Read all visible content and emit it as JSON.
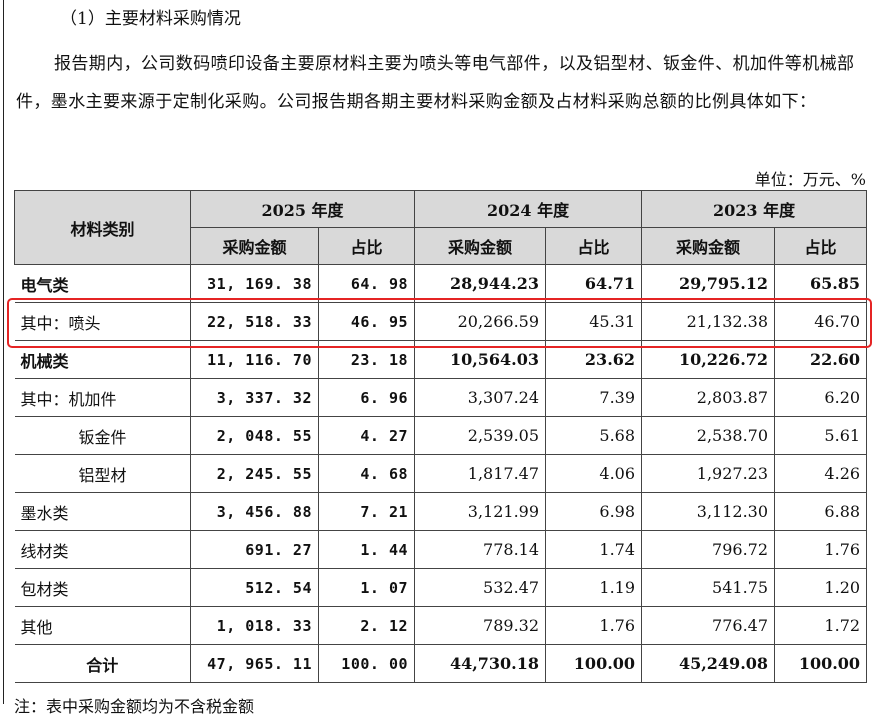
{
  "section_heading": "（1）主要材料采购情况",
  "paragraph": "报告期内，公司数码喷印设备主要原材料主要为喷头等电气部件，以及铝型材、钣金件、机加件等机械部件，墨水主要来源于定制化采购。公司报告期各期主要材料采购金额及占材料采购总额的比例具体如下：",
  "unit_label": "单位：万元、%",
  "table": {
    "category_header": "材料类别",
    "years": [
      "2025 年度",
      "2024 年度",
      "2023 年度"
    ],
    "amount_header": "采购金额",
    "ratio_header": "占比",
    "rows": [
      {
        "label": "电气类",
        "v": [
          "31, 169. 38",
          "64. 98",
          "28,944.23",
          "64.71",
          "29,795.12",
          "65.85"
        ]
      },
      {
        "label": "其中：喷头",
        "v": [
          "22, 518. 33",
          "46. 95",
          "20,266.59",
          "45.31",
          "21,132.38",
          "46.70"
        ]
      },
      {
        "label": "机械类",
        "v": [
          "11, 116. 70",
          "23. 18",
          "10,564.03",
          "23.62",
          "10,226.72",
          "22.60"
        ]
      },
      {
        "label": "其中：机加件",
        "v": [
          "3, 337. 32",
          "6. 96",
          "3,307.24",
          "7.39",
          "2,803.87",
          "6.20"
        ]
      },
      {
        "label": "钣金件",
        "v": [
          "2, 048. 55",
          "4. 27",
          "2,539.05",
          "5.68",
          "2,538.70",
          "5.61"
        ]
      },
      {
        "label": "铝型材",
        "v": [
          "2, 245. 55",
          "4. 68",
          "1,817.47",
          "4.06",
          "1,927.23",
          "4.26"
        ]
      },
      {
        "label": "墨水类",
        "v": [
          "3, 456. 88",
          "7. 21",
          "3,121.99",
          "6.98",
          "3,112.30",
          "6.88"
        ]
      },
      {
        "label": "线材类",
        "v": [
          "691. 27",
          "1. 44",
          "778.14",
          "1.74",
          "796.72",
          "1.76"
        ]
      },
      {
        "label": "包材类",
        "v": [
          "512. 54",
          "1. 07",
          "532.47",
          "1.19",
          "541.75",
          "1.20"
        ]
      },
      {
        "label": "其他",
        "v": [
          "1, 018. 33",
          "2. 12",
          "789.32",
          "1.76",
          "776.47",
          "1.72"
        ]
      },
      {
        "label": "合计",
        "v": [
          "47, 965. 11",
          "100. 00",
          "44,730.18",
          "100.00",
          "45,249.08",
          "100.00"
        ]
      }
    ]
  },
  "footnote": "注：表中采购金额均为不含税金额",
  "highlight_color": "#e52424"
}
